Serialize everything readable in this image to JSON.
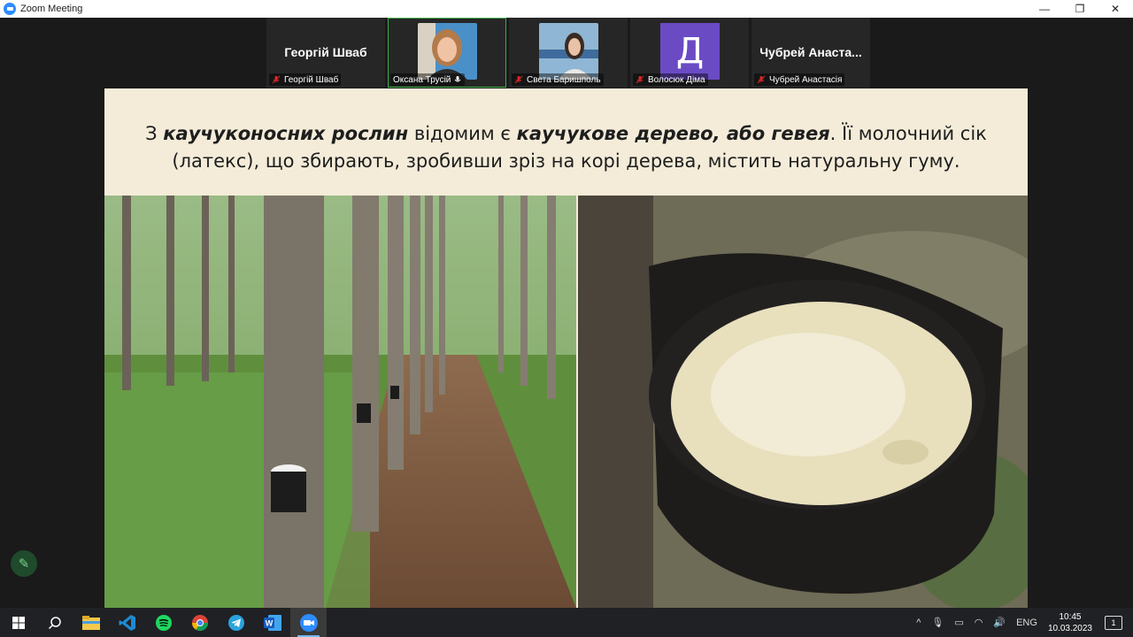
{
  "window": {
    "title": "Zoom Meeting",
    "controls": [
      "—",
      "❐",
      "✕"
    ]
  },
  "participants": [
    {
      "big_name": "Георгій Шваб",
      "label": "Георгій Шваб",
      "muted": true,
      "kind": "name"
    },
    {
      "big_name": "",
      "label": "Оксана Трусій",
      "muted": false,
      "kind": "photo",
      "active": true
    },
    {
      "big_name": "",
      "label": "Света Баришполь",
      "muted": true,
      "kind": "photo"
    },
    {
      "big_name": "Д",
      "label": "Волосюк Діма",
      "muted": true,
      "kind": "avatar"
    },
    {
      "big_name": "Чубрей  Анаста...",
      "label": "Чубрей Анастасія",
      "muted": true,
      "kind": "name"
    }
  ],
  "slide": {
    "line1_a": "З ",
    "line1_b": "каучуконосних рослин",
    "line1_c": " відомим є ",
    "line1_d": "каучукове дерево, або гевея",
    "line1_e": ". Її молочний сік",
    "line2": "(латекс), що збирають, зробивши зріз на корі дерева, містить натуральну гуму."
  },
  "taskbar": {
    "apps": [
      "start-icon",
      "search-icon",
      "file-explorer-icon",
      "vscode-icon",
      "spotify-icon",
      "chrome-icon",
      "telegram-icon",
      "word-icon",
      "zoom-icon"
    ],
    "lang": "ENG",
    "time": "10:45",
    "date": "10.03.2023",
    "notifications": "1"
  },
  "colors": {
    "active_border": "#3fae49",
    "avatar": "#6a4bc4",
    "zoom_blue": "#2d8cff"
  }
}
